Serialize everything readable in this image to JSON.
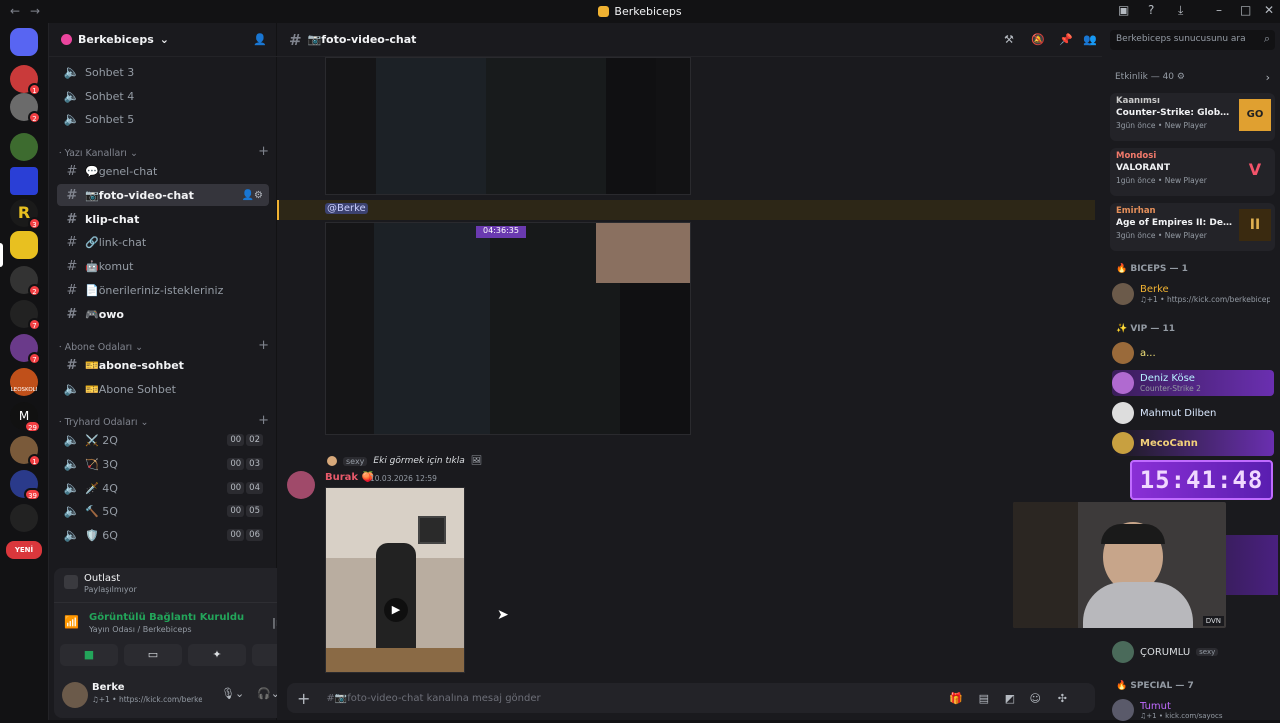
{
  "window": {
    "title": "Berkebiceps"
  },
  "guilds": [
    {
      "name": "discord-home",
      "color": "#5865f2",
      "badge": ""
    },
    {
      "name": "server-red",
      "color": "#c93a3a",
      "badge": "1"
    },
    {
      "name": "server-gray",
      "color": "#6b6b6b",
      "badge": "2"
    },
    {
      "name": "server-green",
      "color": "#3d6b2f",
      "badge": ""
    },
    {
      "name": "server-blue",
      "color": "#2a3fd6",
      "badge": ""
    },
    {
      "name": "server-r",
      "color": "#1a1a1a",
      "badge": "3"
    },
    {
      "name": "server-b",
      "color": "#e8c020",
      "badge": ""
    },
    {
      "name": "server-dark",
      "color": "#333",
      "badge": "2"
    },
    {
      "name": "server-crown",
      "color": "#222",
      "badge": "7"
    },
    {
      "name": "server-art",
      "color": "#6a3a8a",
      "badge": "7"
    },
    {
      "name": "server-leoskoli",
      "color": "#c0501a",
      "badge": ""
    },
    {
      "name": "server-m",
      "color": "#111",
      "badge": "29"
    },
    {
      "name": "server-photo",
      "color": "#7a5a3a",
      "badge": "1"
    },
    {
      "name": "server-ring",
      "color": "#2a3a8a",
      "badge": "39"
    },
    {
      "name": "server-figure",
      "color": "#222",
      "badge": ""
    }
  ],
  "guild_labels": {
    "leoskoli": "LEOSKOLI",
    "m": "M",
    "r": "R",
    "yeni": "YENİ"
  },
  "server": {
    "name": "Berkebiceps"
  },
  "channels": {
    "voice_top": [
      {
        "label": "Sohbet 3"
      },
      {
        "label": "Sohbet 4"
      },
      {
        "label": "Sohbet 5"
      }
    ],
    "text_category": "Yazı Kanalları",
    "text": [
      {
        "label": "💬genel-chat",
        "sel": false,
        "unread": false
      },
      {
        "label": "📷foto-video-chat",
        "sel": true,
        "unread": true
      },
      {
        "label": "klip-chat",
        "sel": false,
        "unread": true
      },
      {
        "label": "🔗link-chat",
        "sel": false,
        "unread": false
      },
      {
        "label": "🤖komut",
        "sel": false,
        "unread": false
      },
      {
        "label": "📄önerileriniz-istekleriniz",
        "sel": false,
        "unread": false
      },
      {
        "label": "🎮owo",
        "sel": false,
        "unread": true
      }
    ],
    "sub_category": "Abone Odaları",
    "sub": [
      {
        "label": "🎫abone-sohbet",
        "unread": true
      },
      {
        "label": "🎫Abone Sohbet",
        "unread": false
      }
    ],
    "tryhard_category": "Tryhard Odaları",
    "tryhard": [
      {
        "label": "⚔️ 2Q",
        "a": "00",
        "b": "02"
      },
      {
        "label": "🏹 3Q",
        "a": "00",
        "b": "03"
      },
      {
        "label": "🗡️ 4Q",
        "a": "00",
        "b": "04"
      },
      {
        "label": "🔨 5Q",
        "a": "00",
        "b": "05"
      },
      {
        "label": "🛡️ 6Q",
        "a": "00",
        "b": "06"
      }
    ]
  },
  "activity_panel": {
    "game": "Outlast",
    "status": "Paylaşılmıyor"
  },
  "voice": {
    "status": "Görüntülü Bağlantı Kuruldu",
    "channel": "Yayın Odası / Berkebiceps"
  },
  "user": {
    "name": "Berke",
    "status": "♫+1 • https://kick.com/berkebiceps"
  },
  "channel_header": {
    "name": "📷foto-video-chat"
  },
  "messages": {
    "mention": "@Berke",
    "reply_text": "Eki görmek için tıkla",
    "reply_badge": "sexy",
    "author": "Burak",
    "timestamp": "10.03.2026 12:59",
    "screenshot_timer": "04:36:35"
  },
  "composer": {
    "placeholder": "#📷foto-video-chat kanalına mesaj gönder"
  },
  "search": {
    "placeholder": "Berkebiceps sunucusunu ara"
  },
  "activity": {
    "header": "Etkinlik — 40",
    "items": [
      {
        "user": "Kaanımsı",
        "game": "Counter-Strike: Global Off...",
        "ago": "3gün önce",
        "tag": "New Player",
        "color": "#c9c9c9",
        "icon": "GO"
      },
      {
        "user": "Mondosi",
        "game": "VALORANT",
        "ago": "1gün önce",
        "tag": "New Player",
        "color": "#f27a6b",
        "icon": "V"
      },
      {
        "user": "Emirhan",
        "game": "Age of Empires II: Definitiv...",
        "ago": "3gün önce",
        "tag": "New Player",
        "color": "#e58f5a",
        "icon": "II"
      }
    ]
  },
  "roles": [
    {
      "name": "BICEPS — 1",
      "members": [
        {
          "name": "Berke",
          "sub": "♫+1 • https://kick.com/berkebiceps",
          "tag": "sexy",
          "color": "#f0b232"
        }
      ]
    },
    {
      "name": "VIP — 11",
      "members": [
        {
          "name": "a...",
          "sub": "",
          "tag": "",
          "color": "#f2e27a"
        },
        {
          "name": "Deniz Köse",
          "sub": "Counter-Strike 2",
          "tag": "",
          "color": "#b7f1ff"
        },
        {
          "name": "Mahmut Dilben",
          "sub": "",
          "tag": "",
          "color": "#dbe9ff"
        },
        {
          "name": "MecoCann",
          "sub": "",
          "tag": "",
          "color": "#f2d07a"
        }
      ]
    },
    {
      "name": "ÇORUMLU",
      "members": []
    },
    {
      "name": "SPECIAL — 7",
      "members": [
        {
          "name": "Tumut",
          "sub": "♫+1 • kick.com/sayocs",
          "tag": "",
          "color": "#c06bff"
        }
      ]
    }
  ],
  "corumlu": {
    "name": "ÇORUMLU",
    "tag": "sexy"
  },
  "overlay": {
    "clock": "15:41:48",
    "cam_label": "DVN"
  }
}
